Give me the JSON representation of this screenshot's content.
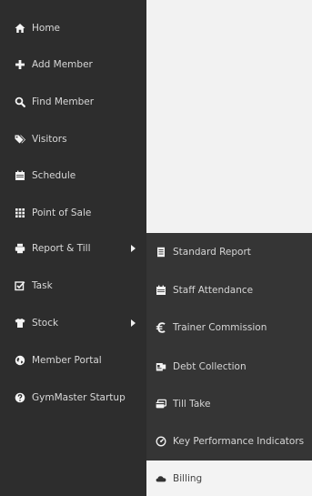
{
  "sidebar": {
    "items": [
      {
        "label": "Home",
        "icon": "home-icon"
      },
      {
        "label": "Add Member",
        "icon": "plus-icon"
      },
      {
        "label": "Find Member",
        "icon": "search-icon"
      },
      {
        "label": "Visitors",
        "icon": "tags-icon"
      },
      {
        "label": "Schedule",
        "icon": "calendar-icon"
      },
      {
        "label": "Point of Sale",
        "icon": "grid-icon"
      },
      {
        "label": "Report & Till",
        "icon": "printer-icon"
      },
      {
        "label": "Task",
        "icon": "checkbox-icon"
      },
      {
        "label": "Stock",
        "icon": "tshirt-icon"
      },
      {
        "label": "Member Portal",
        "icon": "globe-icon"
      },
      {
        "label": "GymMaster Startup",
        "icon": "question-icon"
      }
    ]
  },
  "submenu": {
    "items": [
      {
        "label": "Standard Report",
        "icon": "document-icon"
      },
      {
        "label": "Staff Attendance",
        "icon": "calendar-icon"
      },
      {
        "label": "Trainer Commission",
        "icon": "euro-icon"
      },
      {
        "label": "Debt Collection",
        "icon": "folder-icon"
      },
      {
        "label": "Till Take",
        "icon": "credit-card-icon"
      },
      {
        "label": "Key Performance Indicators",
        "icon": "dashboard-icon"
      },
      {
        "label": "Billing",
        "icon": "cloud-icon"
      }
    ]
  },
  "colors": {
    "sidebar_bg": "#2d2d2d",
    "submenu_bg": "#353535",
    "content_bg": "#f2f2f2",
    "active_bg": "#f3f3f3"
  }
}
